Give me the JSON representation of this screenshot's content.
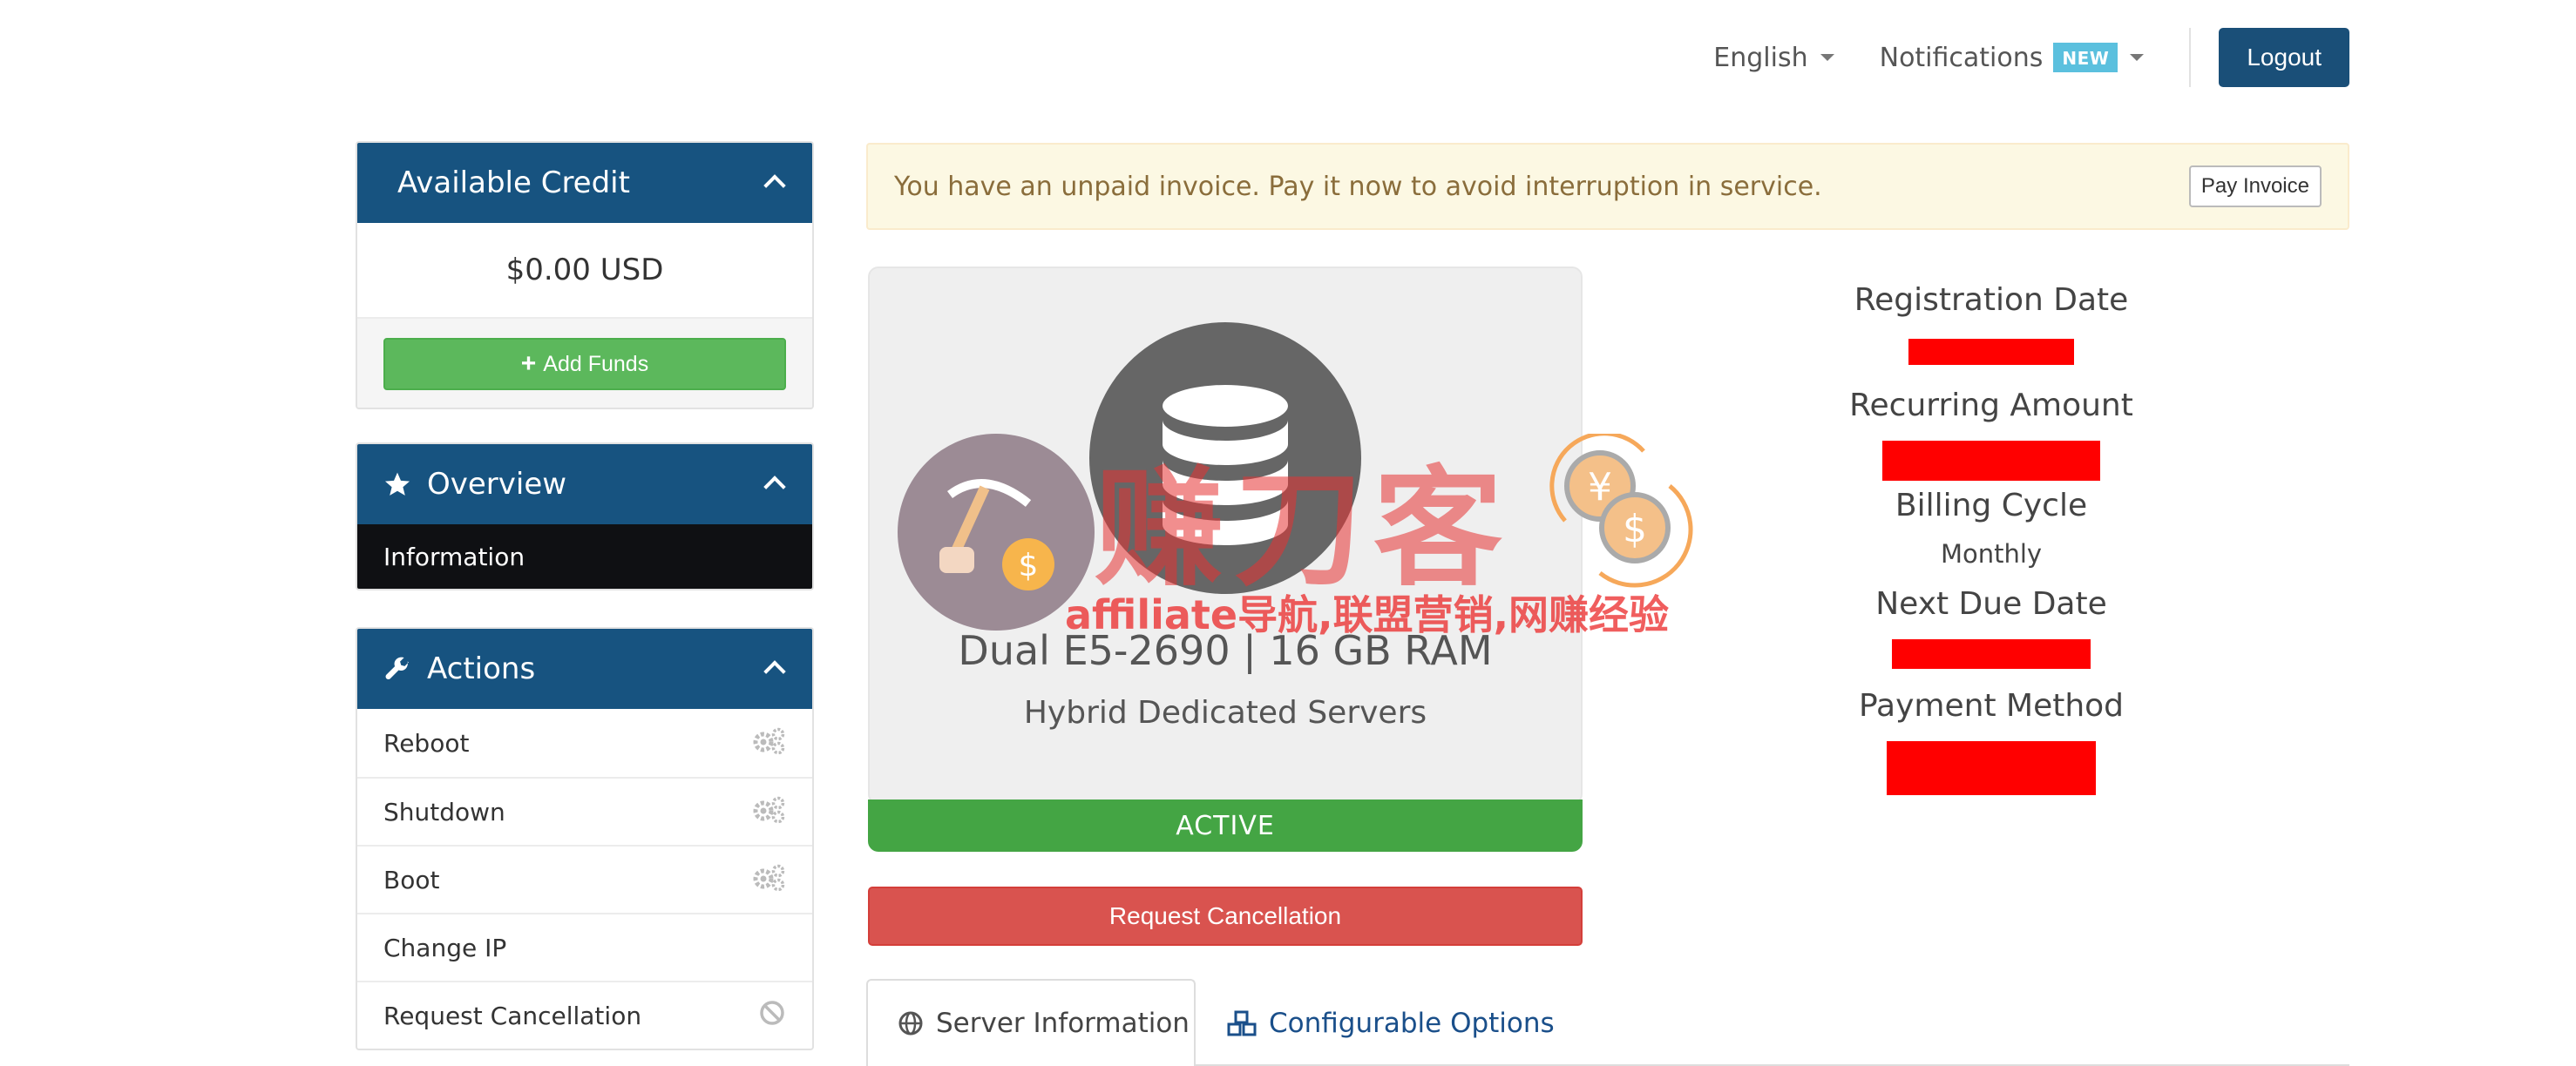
{
  "topbar": {
    "language": "English",
    "notifications": "Notifications",
    "notifications_badge": "NEW",
    "logout": "Logout"
  },
  "sidebar": {
    "credit": {
      "title": "Available Credit",
      "amount": "$0.00 USD",
      "add_funds": "Add Funds"
    },
    "overview": {
      "title": "Overview",
      "items": [
        {
          "label": "Information"
        }
      ]
    },
    "actions": {
      "title": "Actions",
      "items": [
        {
          "label": "Reboot",
          "icon": "gears-icon"
        },
        {
          "label": "Shutdown",
          "icon": "gears-icon"
        },
        {
          "label": "Boot",
          "icon": "gears-icon"
        },
        {
          "label": "Change IP",
          "icon": ""
        },
        {
          "label": "Request Cancellation",
          "icon": "ban-icon"
        }
      ]
    }
  },
  "alert": {
    "text": "You have an unpaid invoice. Pay it now to avoid interruption in service.",
    "button": "Pay Invoice"
  },
  "product": {
    "name": "Dual E5-2690 | 16 GB RAM",
    "group": "Hybrid Dedicated Servers",
    "status": "ACTIVE",
    "icon": "database-icon"
  },
  "request_cancellation": "Request Cancellation",
  "details": {
    "registration_date": "Registration Date",
    "recurring_amount": "Recurring Amount",
    "billing_cycle": "Billing Cycle",
    "billing_cycle_value": "Monthly",
    "next_due_date": "Next Due Date",
    "payment_method": "Payment Method"
  },
  "tabs": [
    {
      "label": "Server Information",
      "icon": "globe-icon"
    },
    {
      "label": "Configurable Options",
      "icon": "cubes-icon"
    }
  ],
  "watermark": {
    "text": "赚刀客",
    "subtitle": "affiliate导航,联盟营销,网赚经验"
  },
  "colors": {
    "brand": "#175380",
    "success": "#5cb85c",
    "danger": "#d9534f",
    "warning_bg": "#fcf8e3",
    "badge": "#5bc0de",
    "redaction": "#ff0000"
  }
}
